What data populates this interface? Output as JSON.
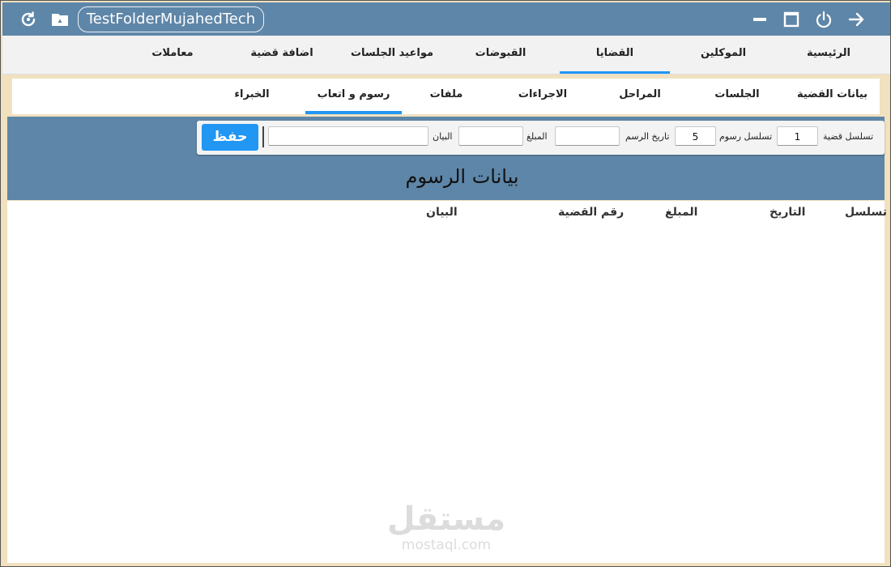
{
  "window": {
    "folder_name": "TestFolderMujahedTech",
    "icons": [
      "refresh-icon",
      "drive-folder-icon",
      "minimize-icon",
      "maximize-icon",
      "power-icon",
      "arrow-right-icon"
    ]
  },
  "main_nav": {
    "tabs": [
      {
        "label": "الرئيسية"
      },
      {
        "label": "الموكلين"
      },
      {
        "label": "القضايا",
        "active": true
      },
      {
        "label": "القبوضات"
      },
      {
        "label": "مواعيد الجلسات"
      },
      {
        "label": "اضافة قضية"
      },
      {
        "label": "معاملات"
      }
    ]
  },
  "sub_nav": {
    "tabs": [
      {
        "label": "بيانات القضية"
      },
      {
        "label": "الجلسات"
      },
      {
        "label": "المراحل"
      },
      {
        "label": "الاجراءات"
      },
      {
        "label": "ملفات"
      },
      {
        "label": "رسوم و اتعاب",
        "active": true
      },
      {
        "label": "الخبراء"
      }
    ]
  },
  "form": {
    "case_seq_label": "تسلسل قضية",
    "case_seq_value": "1",
    "fee_seq_label": "تسلسل رسوم",
    "fee_seq_value": "5",
    "fee_date_label": "تاريخ الرسم",
    "fee_date_value": "",
    "amount_label": "المبلغ",
    "amount_value": "",
    "statement_label": "البيان",
    "statement_value": "",
    "save_label": "حفظ"
  },
  "panel_title": "بيانات الرسوم",
  "table": {
    "columns": [
      "تسلسل",
      "التاريخ",
      "المبلغ",
      "رقم القضية",
      "البيان"
    ],
    "rows": []
  },
  "watermark": {
    "arabic": "مستقل",
    "latin": "mostaql.com"
  },
  "colors": {
    "titlebar": "#5e86a8",
    "accent": "#2196f3",
    "frame_bg": "#f1e1bf"
  }
}
